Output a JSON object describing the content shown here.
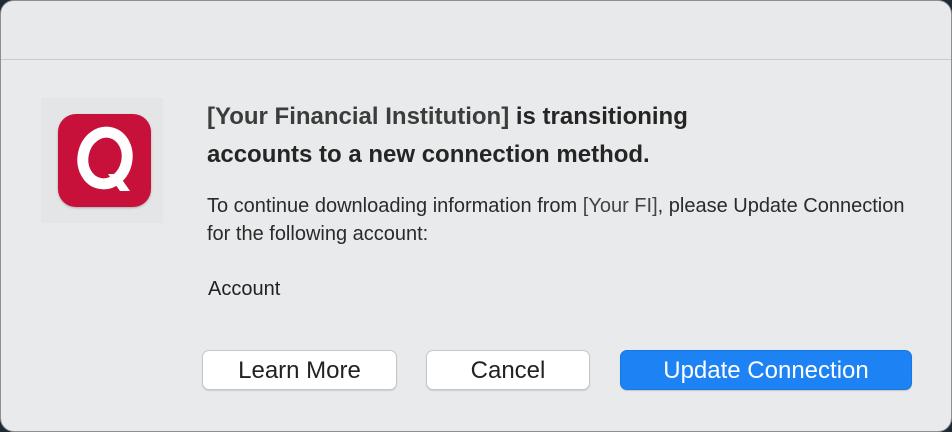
{
  "dialog": {
    "headline_fi": "[Your Financial Institution]",
    "headline_line1_rest": " is transitioning",
    "headline_line2": "accounts to a new connection method.",
    "message_part1": "To continue downloading information from ",
    "message_fi_short": "[Your FI]",
    "message_part2": ", please Update Connection for the following account:",
    "account_label": "Account"
  },
  "app_icon": {
    "name": "quicken-q-icon",
    "letter": "Q",
    "color": "#c7103a"
  },
  "buttons": {
    "learn_more": "Learn More",
    "cancel": "Cancel",
    "update_connection": "Update Connection"
  },
  "colors": {
    "primary_button": "#1d82f4",
    "dialog_background": "#e9eaeb"
  }
}
